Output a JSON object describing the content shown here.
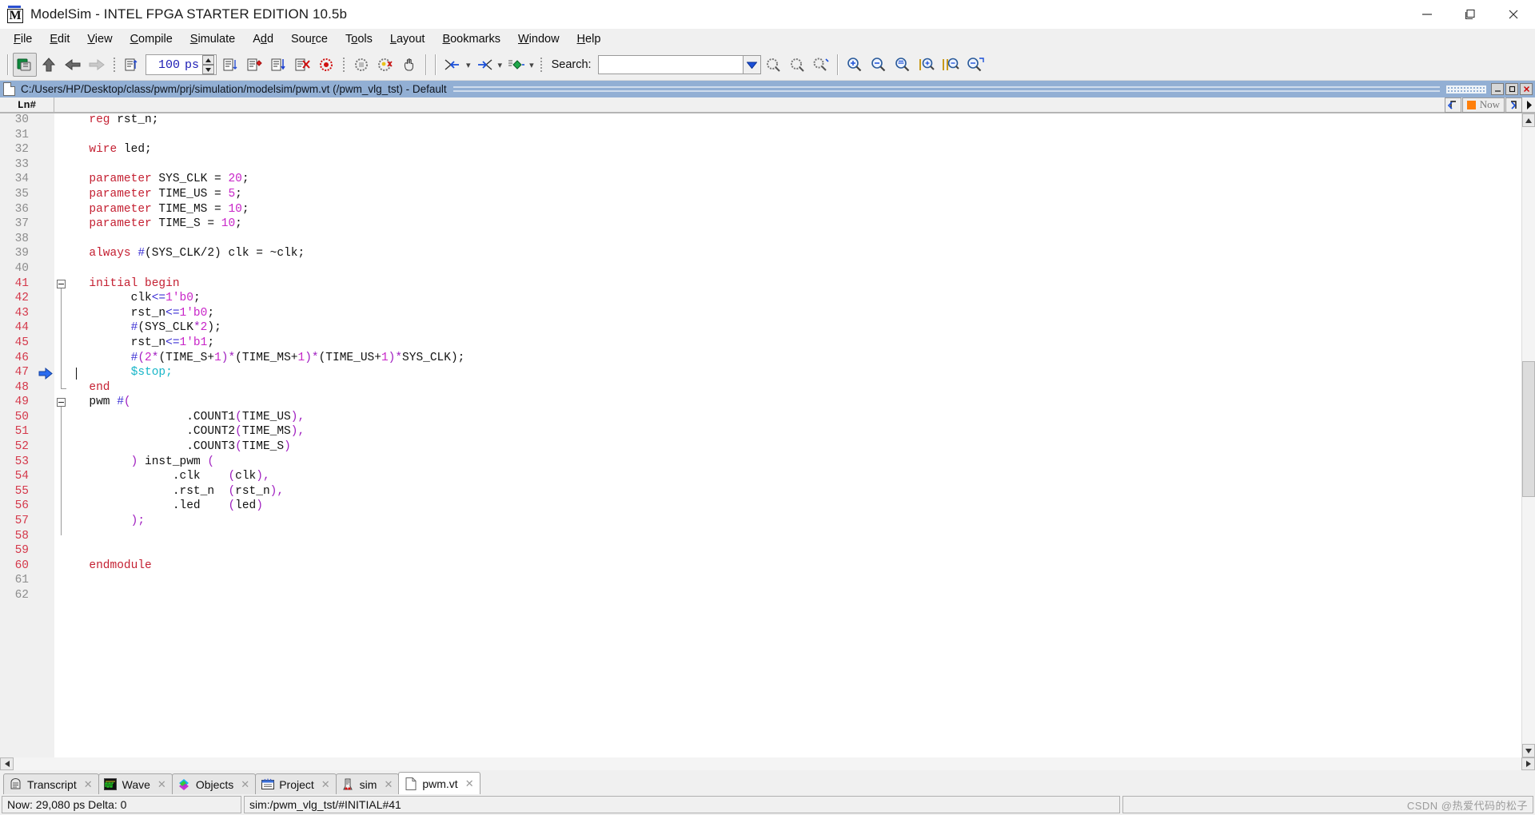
{
  "window": {
    "title": "ModelSim - INTEL FPGA STARTER EDITION 10.5b",
    "minimize_label": "–",
    "maximize_label": "❐",
    "close_label": "✕"
  },
  "menubar": {
    "items": [
      {
        "label": "File",
        "mnemonic": "F"
      },
      {
        "label": "Edit",
        "mnemonic": "E"
      },
      {
        "label": "View",
        "mnemonic": "V"
      },
      {
        "label": "Compile",
        "mnemonic": "C"
      },
      {
        "label": "Simulate",
        "mnemonic": "S"
      },
      {
        "label": "Add",
        "mnemonic": "d"
      },
      {
        "label": "Source",
        "mnemonic": "r"
      },
      {
        "label": "Tools",
        "mnemonic": "o"
      },
      {
        "label": "Layout",
        "mnemonic": "L"
      },
      {
        "label": "Bookmarks",
        "mnemonic": "B"
      },
      {
        "label": "Window",
        "mnemonic": "W"
      },
      {
        "label": "Help",
        "mnemonic": "H"
      }
    ]
  },
  "toolbar": {
    "run_length_value": "100",
    "run_length_unit": "ps",
    "search_label": "Search:",
    "search_value": "",
    "search_placeholder": ""
  },
  "document": {
    "path_title": "C:/Users/HP/Desktop/class/pwm/prj/simulation/modelsim/pwm.vt (/pwm_vlg_tst) - Default",
    "minimize_label": "–",
    "restore_label": "❐",
    "close_label": "✕"
  },
  "editor": {
    "gutter_header": "Ln#",
    "now_label": "Now",
    "first_line": 30,
    "exec_marker_line": 47,
    "exec_line_start": 41,
    "exec_line_end": 60,
    "lines": [
      {
        "n": 30,
        "tokens": [
          {
            "t": "  ",
            "c": "id"
          },
          {
            "t": "reg",
            "c": "kw"
          },
          {
            "t": " rst_n;",
            "c": "id"
          }
        ]
      },
      {
        "n": 31,
        "tokens": []
      },
      {
        "n": 32,
        "tokens": [
          {
            "t": "  ",
            "c": "id"
          },
          {
            "t": "wire",
            "c": "kw"
          },
          {
            "t": " led;",
            "c": "id"
          }
        ]
      },
      {
        "n": 33,
        "tokens": []
      },
      {
        "n": 34,
        "tokens": [
          {
            "t": "  ",
            "c": "id"
          },
          {
            "t": "parameter",
            "c": "kw"
          },
          {
            "t": " SYS_CLK = ",
            "c": "id"
          },
          {
            "t": "20",
            "c": "num"
          },
          {
            "t": ";",
            "c": "id"
          }
        ]
      },
      {
        "n": 35,
        "tokens": [
          {
            "t": "  ",
            "c": "id"
          },
          {
            "t": "parameter",
            "c": "kw"
          },
          {
            "t": " TIME_US = ",
            "c": "id"
          },
          {
            "t": "5",
            "c": "num"
          },
          {
            "t": ";",
            "c": "id"
          }
        ]
      },
      {
        "n": 36,
        "tokens": [
          {
            "t": "  ",
            "c": "id"
          },
          {
            "t": "parameter",
            "c": "kw"
          },
          {
            "t": " TIME_MS = ",
            "c": "id"
          },
          {
            "t": "10",
            "c": "num"
          },
          {
            "t": ";",
            "c": "id"
          }
        ]
      },
      {
        "n": 37,
        "tokens": [
          {
            "t": "  ",
            "c": "id"
          },
          {
            "t": "parameter",
            "c": "kw"
          },
          {
            "t": " TIME_S = ",
            "c": "id"
          },
          {
            "t": "10",
            "c": "num"
          },
          {
            "t": ";",
            "c": "id"
          }
        ]
      },
      {
        "n": 38,
        "tokens": []
      },
      {
        "n": 39,
        "tokens": [
          {
            "t": "  ",
            "c": "id"
          },
          {
            "t": "always",
            "c": "kw"
          },
          {
            "t": " ",
            "c": "id"
          },
          {
            "t": "#",
            "c": "op"
          },
          {
            "t": "(SYS_CLK/2)",
            "c": "id"
          },
          {
            "t": " clk = ~clk;",
            "c": "id"
          }
        ]
      },
      {
        "n": 40,
        "tokens": []
      },
      {
        "n": 41,
        "tokens": [
          {
            "t": "  ",
            "c": "id"
          },
          {
            "t": "initial",
            "c": "kw"
          },
          {
            "t": " ",
            "c": "id"
          },
          {
            "t": "begin",
            "c": "kw"
          }
        ]
      },
      {
        "n": 42,
        "tokens": [
          {
            "t": "        clk",
            "c": "id"
          },
          {
            "t": "<=",
            "c": "op"
          },
          {
            "t": "1",
            "c": "num"
          },
          {
            "t": "'b0",
            "c": "num"
          },
          {
            "t": ";",
            "c": "id"
          }
        ]
      },
      {
        "n": 43,
        "tokens": [
          {
            "t": "        rst_n",
            "c": "id"
          },
          {
            "t": "<=",
            "c": "op"
          },
          {
            "t": "1",
            "c": "num"
          },
          {
            "t": "'b0",
            "c": "num"
          },
          {
            "t": ";",
            "c": "id"
          }
        ]
      },
      {
        "n": 44,
        "tokens": [
          {
            "t": "        ",
            "c": "id"
          },
          {
            "t": "#",
            "c": "op"
          },
          {
            "t": "(SYS_CLK",
            "c": "id"
          },
          {
            "t": "*",
            "c": "pnc"
          },
          {
            "t": "2",
            "c": "num"
          },
          {
            "t": ")",
            "c": "id"
          },
          {
            "t": ";",
            "c": "id"
          }
        ]
      },
      {
        "n": 45,
        "tokens": [
          {
            "t": "        rst_n",
            "c": "id"
          },
          {
            "t": "<=",
            "c": "op"
          },
          {
            "t": "1",
            "c": "num"
          },
          {
            "t": "'b1",
            "c": "num"
          },
          {
            "t": ";",
            "c": "id"
          }
        ]
      },
      {
        "n": 46,
        "tokens": [
          {
            "t": "        ",
            "c": "id"
          },
          {
            "t": "#",
            "c": "op"
          },
          {
            "t": "(",
            "c": "pnc"
          },
          {
            "t": "2",
            "c": "num"
          },
          {
            "t": "*",
            "c": "pnc"
          },
          {
            "t": "(TIME_S+",
            "c": "id"
          },
          {
            "t": "1",
            "c": "num"
          },
          {
            "t": ")",
            "c": "pnc"
          },
          {
            "t": "*",
            "c": "pnc"
          },
          {
            "t": "(TIME_MS+",
            "c": "id"
          },
          {
            "t": "1",
            "c": "num"
          },
          {
            "t": ")",
            "c": "pnc"
          },
          {
            "t": "*",
            "c": "pnc"
          },
          {
            "t": "(TIME_US+",
            "c": "id"
          },
          {
            "t": "1",
            "c": "num"
          },
          {
            "t": ")",
            "c": "pnc"
          },
          {
            "t": "*",
            "c": "pnc"
          },
          {
            "t": "SYS_CLK);",
            "c": "id"
          }
        ]
      },
      {
        "n": 47,
        "tokens": [
          {
            "t": "        ",
            "c": "id"
          },
          {
            "t": "$stop",
            "c": "sys"
          },
          {
            "t": ";",
            "c": "sys"
          }
        ]
      },
      {
        "n": 48,
        "tokens": [
          {
            "t": "  ",
            "c": "id"
          },
          {
            "t": "end",
            "c": "kw"
          }
        ]
      },
      {
        "n": 49,
        "tokens": [
          {
            "t": "  pwm ",
            "c": "id"
          },
          {
            "t": "#",
            "c": "op"
          },
          {
            "t": "(",
            "c": "pnc"
          }
        ]
      },
      {
        "n": 50,
        "tokens": [
          {
            "t": "                .COUNT1",
            "c": "id"
          },
          {
            "t": "(",
            "c": "pnc"
          },
          {
            "t": "TIME_US",
            "c": "id"
          },
          {
            "t": "),",
            "c": "pnc"
          }
        ]
      },
      {
        "n": 51,
        "tokens": [
          {
            "t": "                .COUNT2",
            "c": "id"
          },
          {
            "t": "(",
            "c": "pnc"
          },
          {
            "t": "TIME_MS",
            "c": "id"
          },
          {
            "t": "),",
            "c": "pnc"
          }
        ]
      },
      {
        "n": 52,
        "tokens": [
          {
            "t": "                .COUNT3",
            "c": "id"
          },
          {
            "t": "(",
            "c": "pnc"
          },
          {
            "t": "TIME_S",
            "c": "id"
          },
          {
            "t": ")",
            "c": "pnc"
          }
        ]
      },
      {
        "n": 53,
        "tokens": [
          {
            "t": "        ",
            "c": "id"
          },
          {
            "t": ")",
            "c": "pnc"
          },
          {
            "t": " inst_pwm ",
            "c": "id"
          },
          {
            "t": "(",
            "c": "pnc"
          }
        ]
      },
      {
        "n": 54,
        "tokens": [
          {
            "t": "              .clk    ",
            "c": "id"
          },
          {
            "t": "(",
            "c": "pnc"
          },
          {
            "t": "clk",
            "c": "id"
          },
          {
            "t": "),",
            "c": "pnc"
          }
        ]
      },
      {
        "n": 55,
        "tokens": [
          {
            "t": "              .rst_n  ",
            "c": "id"
          },
          {
            "t": "(",
            "c": "pnc"
          },
          {
            "t": "rst_n",
            "c": "id"
          },
          {
            "t": "),",
            "c": "pnc"
          }
        ]
      },
      {
        "n": 56,
        "tokens": [
          {
            "t": "              .led    ",
            "c": "id"
          },
          {
            "t": "(",
            "c": "pnc"
          },
          {
            "t": "led",
            "c": "id"
          },
          {
            "t": ")",
            "c": "pnc"
          }
        ]
      },
      {
        "n": 57,
        "tokens": [
          {
            "t": "        ",
            "c": "id"
          },
          {
            "t": ");",
            "c": "pnc"
          }
        ]
      },
      {
        "n": 58,
        "tokens": []
      },
      {
        "n": 59,
        "tokens": []
      },
      {
        "n": 60,
        "tokens": [
          {
            "t": "  ",
            "c": "id"
          },
          {
            "t": "endmodule",
            "c": "kw"
          }
        ]
      },
      {
        "n": 61,
        "tokens": []
      },
      {
        "n": 62,
        "tokens": []
      }
    ]
  },
  "tabs": [
    {
      "label": "Transcript",
      "icon": "transcript-icon",
      "active": false
    },
    {
      "label": "Wave",
      "icon": "wave-icon",
      "active": false
    },
    {
      "label": "Objects",
      "icon": "objects-icon",
      "active": false
    },
    {
      "label": "Project",
      "icon": "project-icon",
      "active": false
    },
    {
      "label": "sim",
      "icon": "sim-icon",
      "active": false
    },
    {
      "label": "pwm.vt",
      "icon": "file-icon",
      "active": true
    }
  ],
  "statusbar": {
    "time": "Now: 29,080 ps  Delta: 0",
    "context": "sim:/pwm_vlg_tst/#INITIAL#41",
    "watermark": "CSDN @热爱代码的松子"
  },
  "colors": {
    "keyword": "#c42032",
    "number": "#c824c8",
    "operator": "#3b2fd4",
    "punctuation": "#a020c0",
    "system_task": "#17b5c8",
    "doc_titlebar": "#92afd4",
    "exec_line_number": "#d4384a",
    "now_marker": "#ff7f0a"
  }
}
